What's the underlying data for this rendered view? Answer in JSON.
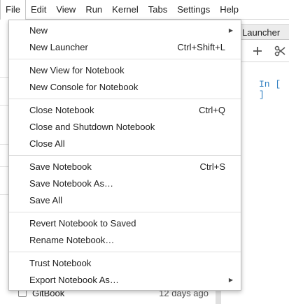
{
  "menubar": {
    "items": [
      "File",
      "Edit",
      "View",
      "Run",
      "Kernel",
      "Tabs",
      "Settings",
      "Help"
    ]
  },
  "file_menu": {
    "items": {
      "new": "New",
      "new_launcher": "New Launcher",
      "new_launcher_shortcut": "Ctrl+Shift+L",
      "new_view": "New View for Notebook",
      "new_console": "New Console for Notebook",
      "close_notebook": "Close Notebook",
      "close_notebook_shortcut": "Ctrl+Q",
      "close_shutdown": "Close and Shutdown Notebook",
      "close_all": "Close All",
      "save_notebook": "Save Notebook",
      "save_notebook_shortcut": "Ctrl+S",
      "save_as": "Save Notebook As…",
      "save_all": "Save All",
      "revert": "Revert Notebook to Saved",
      "rename": "Rename Notebook…",
      "trust": "Trust Notebook",
      "export": "Export Notebook As…"
    }
  },
  "background": {
    "tab_label": "Launcher",
    "cell_prompt": "In [ ]",
    "file_name": "GitBook",
    "file_date": "12 days ago"
  },
  "icons": {
    "submenu": "chevron-right-icon",
    "add": "plus-icon",
    "cut": "scissors-icon"
  },
  "colors": {
    "prompt": "#307fc1"
  }
}
